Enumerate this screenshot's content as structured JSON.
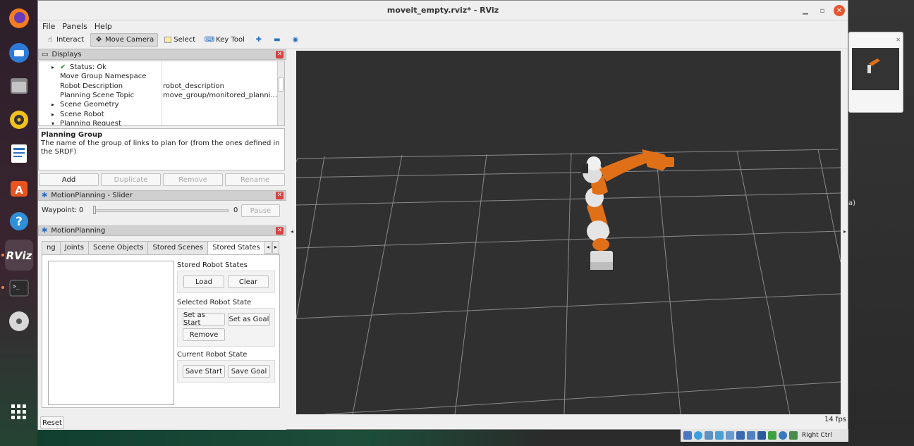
{
  "window": {
    "title": "moveit_empty.rviz* - RViz"
  },
  "menu": [
    "File",
    "Panels",
    "Help"
  ],
  "toolbar": {
    "interact": "Interact",
    "move_camera": "Move Camera",
    "select": "Select",
    "key_tool": "Key Tool"
  },
  "displays": {
    "title": "Displays",
    "rows": [
      {
        "key": "Status: Ok",
        "value": ""
      },
      {
        "key": "Move Group Namespace",
        "value": ""
      },
      {
        "key": "Robot Description",
        "value": "robot_description"
      },
      {
        "key": "Planning Scene Topic",
        "value": "move_group/monitored_planni..."
      },
      {
        "key": "Scene Geometry",
        "value": ""
      },
      {
        "key": "Scene Robot",
        "value": ""
      },
      {
        "key": "Planning Request",
        "value": ""
      }
    ],
    "desc_title": "Planning Group",
    "desc_text": "The name of the group of links to plan for (from the ones defined in the SRDF)",
    "buttons": {
      "add": "Add",
      "duplicate": "Duplicate",
      "remove": "Remove",
      "rename": "Rename"
    }
  },
  "slider_panel": {
    "title": "MotionPlanning - Slider",
    "waypoint_label": "Waypoint:",
    "min": "0",
    "max": "0",
    "pause": "Pause"
  },
  "motion_planning": {
    "title": "MotionPlanning",
    "tabs": [
      "ng",
      "Joints",
      "Scene Objects",
      "Stored Scenes",
      "Stored States"
    ],
    "stored_robot_states": "Stored Robot States",
    "load": "Load",
    "clear": "Clear",
    "selected_robot_state": "Selected Robot State",
    "set_as_start": "Set as Start",
    "set_as_goal": "Set as Goal",
    "remove": "Remove",
    "current_robot_state": "Current Robot State",
    "save_start": "Save Start",
    "save_goal": "Save Goal"
  },
  "footer": {
    "reset": "Reset",
    "fps": "14 fps"
  },
  "tray": {
    "right_ctrl": "Right Ctrl"
  },
  "right_edge_text": "a)",
  "colors": {
    "robot_orange": "#e07018",
    "robot_white": "#dcdcdc",
    "viewport_bg": "#303030",
    "grid": "#8a8a8a"
  }
}
